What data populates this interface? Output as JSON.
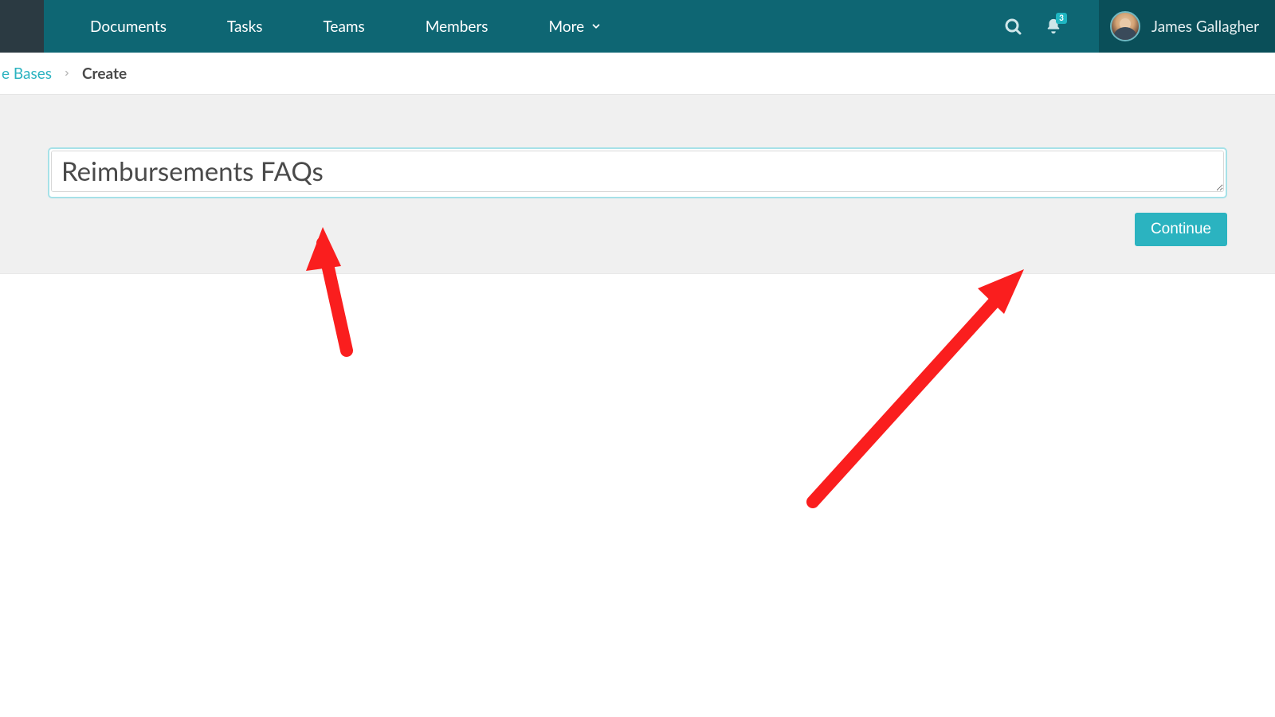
{
  "nav": {
    "items": [
      {
        "label": "Documents"
      },
      {
        "label": "Tasks"
      },
      {
        "label": "Teams"
      },
      {
        "label": "Members"
      },
      {
        "label": "More",
        "dropdown": true
      }
    ]
  },
  "notifications": {
    "count": "3"
  },
  "user": {
    "name": "James Gallagher"
  },
  "breadcrumb": {
    "parent_fragment": "e Bases",
    "current": "Create"
  },
  "form": {
    "title_value": "Reimbursements FAQs",
    "continue_label": "Continue"
  }
}
